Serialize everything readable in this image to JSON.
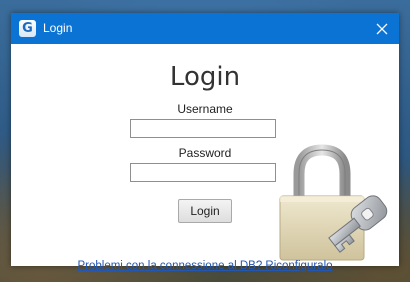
{
  "window": {
    "title": "Login",
    "app_icon_letter": "G"
  },
  "form": {
    "heading": "Login",
    "username_label": "Username",
    "username_value": "",
    "password_label": "Password",
    "password_value": "",
    "login_button": "Login"
  },
  "footer": {
    "link_text": "Problemi con la connessione al DB? Riconfiguralo"
  },
  "colors": {
    "titlebar": "#0a73d4",
    "link": "#2357b4"
  },
  "icons": [
    "app-icon",
    "close-icon",
    "padlock-key-icon"
  ]
}
